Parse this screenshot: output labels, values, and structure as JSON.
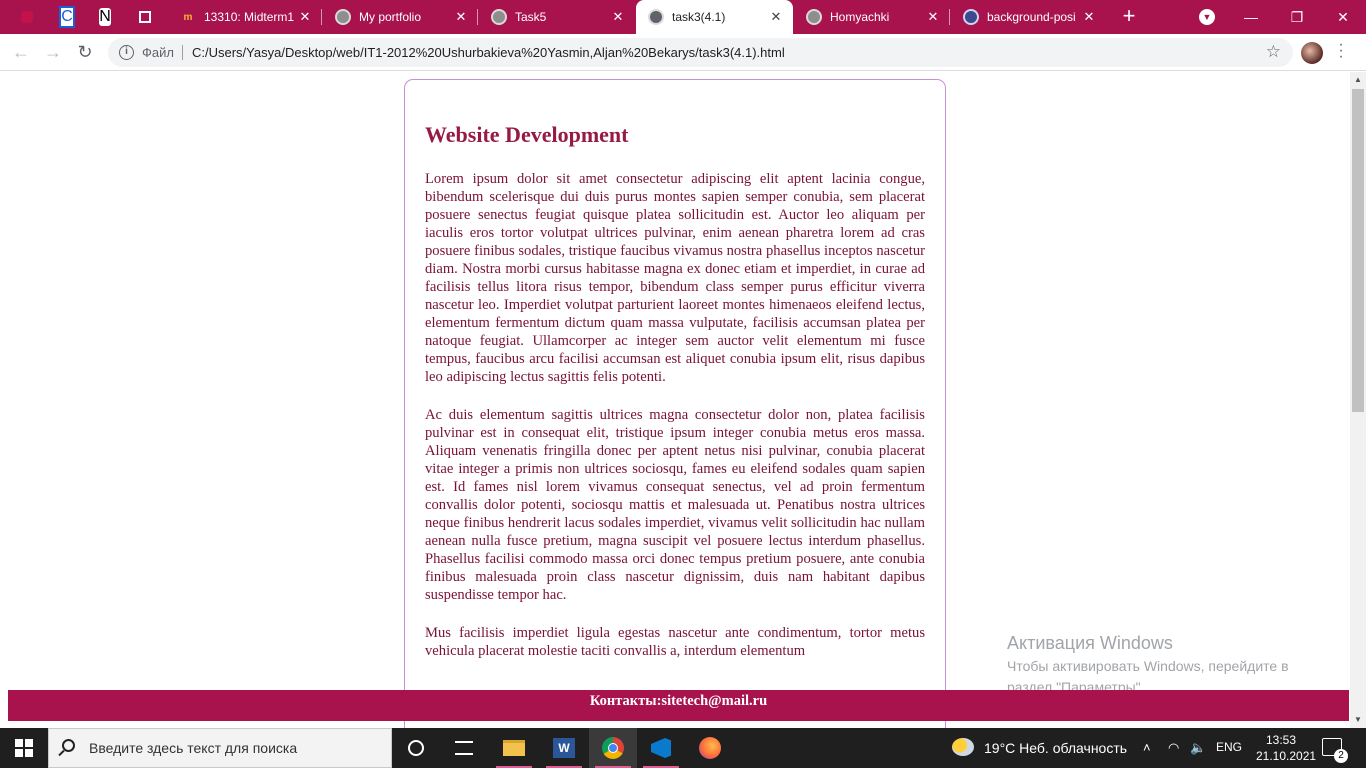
{
  "browser": {
    "tabs": [
      {
        "title": "13310: Midterm1"
      },
      {
        "title": "My portfolio"
      },
      {
        "title": "Task5"
      },
      {
        "title": "task3(4.1)"
      },
      {
        "title": "Homyachki"
      },
      {
        "title": "background-posi"
      }
    ],
    "pinned": [
      "C",
      "N"
    ],
    "address": {
      "scheme_label": "Файл",
      "url": "C:/Users/Yasya/Desktop/web/IT1-2012%20Ushurbakieva%20Yasmin,Aljan%20Bekarys/task3(4.1).html"
    }
  },
  "page": {
    "heading": "Website Development",
    "paragraphs": [
      "Lorem ipsum dolor sit amet consectetur adipiscing elit aptent lacinia congue, bibendum scelerisque dui duis purus montes sapien semper conubia, sem placerat posuere senectus feugiat quisque platea sollicitudin est. Auctor leo aliquam per iaculis eros tortor volutpat ultrices pulvinar, enim aenean pharetra lorem ad cras posuere finibus sodales, tristique faucibus vivamus nostra phasellus inceptos nascetur diam. Nostra morbi cursus habitasse magna ex donec etiam et imperdiet, in curae ad facilisis tellus litora risus tempor, bibendum class semper purus efficitur viverra nascetur leo. Imperdiet volutpat parturient laoreet montes himenaeos eleifend lectus, elementum fermentum dictum quam massa vulputate, facilisis accumsan platea per natoque feugiat. Ullamcorper ac integer sem auctor velit elementum mi fusce tempus, faucibus arcu facilisi accumsan est aliquet conubia ipsum elit, risus dapibus leo adipiscing lectus sagittis felis potenti.",
      "Ac duis elementum sagittis ultrices magna consectetur dolor non, platea facilisis pulvinar est in consequat elit, tristique ipsum integer conubia metus eros massa. Aliquam venenatis fringilla donec per aptent netus nisi pulvinar, conubia placerat vitae integer a primis non ultrices sociosqu, fames eu eleifend sodales quam sapien est. Id fames nisl lorem vivamus consequat senectus, vel ad proin fermentum convallis dolor potenti, sociosqu mattis et malesuada ut. Penatibus nostra ultrices neque finibus hendrerit lacus sodales imperdiet, vivamus velit sollicitudin hac nullam aenean nulla fusce pretium, magna suscipit vel posuere lectus interdum phasellus. Phasellus facilisi commodo massa orci donec tempus pretium posuere, ante conubia finibus malesuada proin class nascetur dignissim, duis nam habitant dapibus suspendisse tempor hac.",
      "Mus facilisis imperdiet ligula egestas nascetur ante condimentum, tortor metus vehicula placerat molestie taciti convallis a, interdum elementum"
    ],
    "footer": "Контакты:sitetech@mail.ru"
  },
  "watermark": {
    "line1": "Активация Windows",
    "line2": "Чтобы активировать Windows, перейдите в",
    "line3": "раздел \"Параметры\"."
  },
  "taskbar": {
    "search_placeholder": "Введите здесь текст для поиска",
    "weather": "19°C  Неб. облачность",
    "language": "ENG",
    "time": "13:53",
    "date": "21.10.2021",
    "notifications": "2"
  },
  "colors": {
    "brand": "#a8134d",
    "heading": "#961a45",
    "text": "#7a1235",
    "card_border": "#c990d6"
  }
}
